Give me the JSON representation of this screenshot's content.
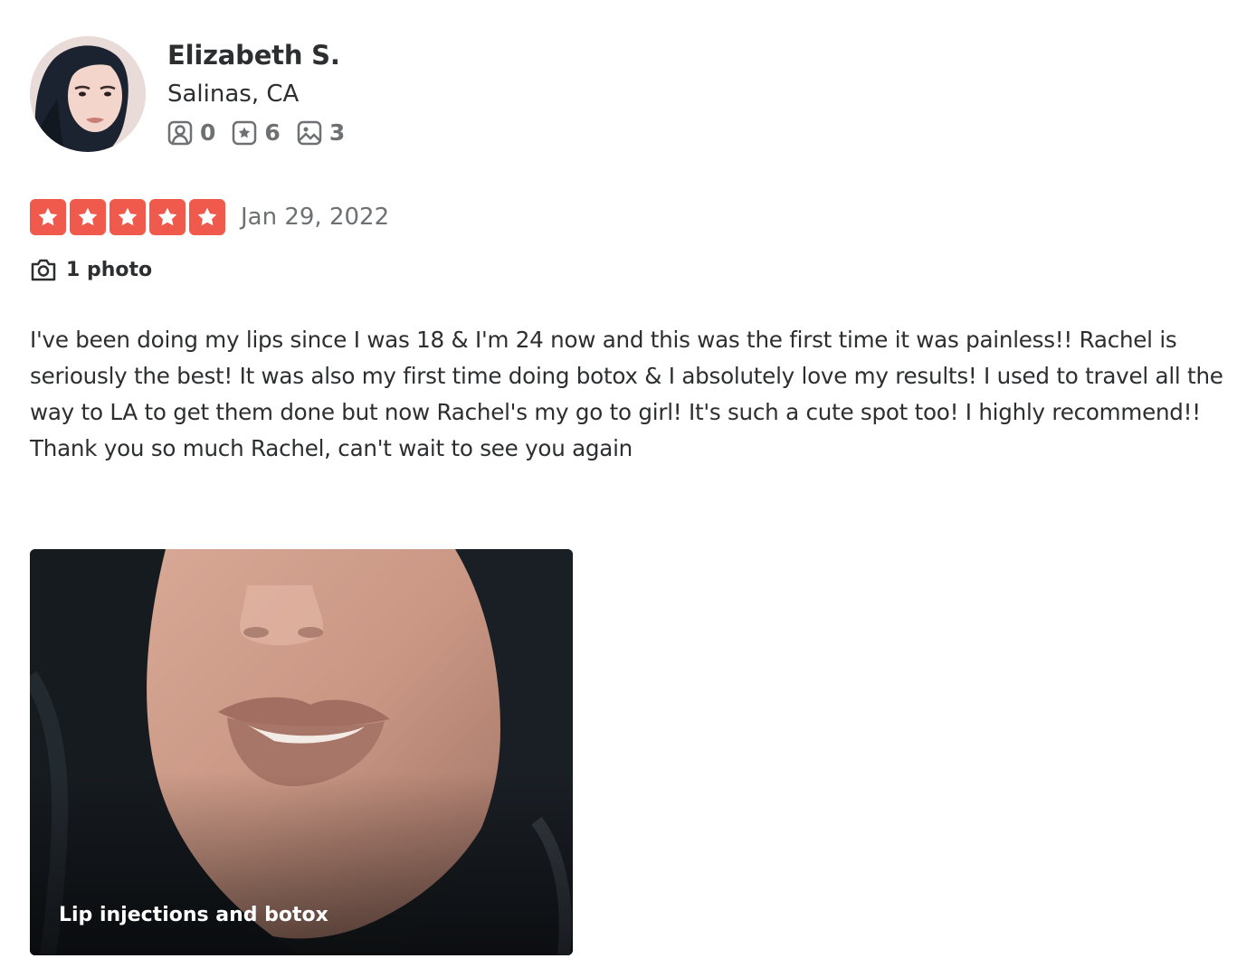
{
  "user": {
    "name": "Elizabeth S.",
    "location": "Salinas, CA",
    "stats": {
      "friends": "0",
      "reviews": "6",
      "photos": "3"
    }
  },
  "review": {
    "rating": 5,
    "rating_max": 5,
    "date": "Jan 29, 2022",
    "photo_count_label": "1 photo",
    "paragraphs": [
      "I've been doing my lips since I was 18 & I'm 24 now and this was the first time it was painless!! Rachel is seriously the best! It was also my first time doing botox & I absolutely love my results! I used to travel all the way to LA to get them done but now Rachel's my go to girl! It's such a cute spot too! I highly recommend!!",
      "Thank you so much Rachel, can't wait to see you again"
    ],
    "photo_caption": "Lip injections and botox"
  },
  "icons": {
    "friends": "friends-icon",
    "reviews": "star-badge-icon",
    "photos": "image-icon",
    "camera": "camera-icon",
    "star": "star-icon"
  },
  "colors": {
    "star_background": "#ef5a4c",
    "text_primary": "#2d2e2f",
    "text_secondary": "#6e7072"
  }
}
